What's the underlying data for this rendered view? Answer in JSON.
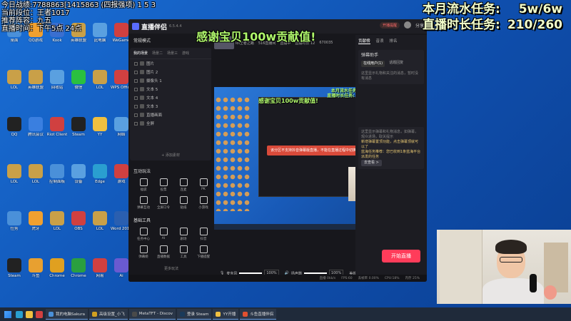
{
  "overlay": {
    "top_left": [
      "今日战绩:7788863[1415863 (四报强项) 1 5 3",
      "当前段位：王者1017",
      "推荐阵容：九五",
      "直播时间：下午5点 24点"
    ],
    "top_right": [
      {
        "label": "本月流水任务:",
        "value": "5w/6w"
      },
      {
        "label": "直播时长任务:",
        "value": "210/260"
      }
    ],
    "center_banner": "感谢宝贝100w贡献值!"
  },
  "desktop_icons": [
    {
      "label": "桌面",
      "color": "#4a90d9"
    },
    {
      "label": "QQ游戏",
      "color": "#f0a030"
    },
    {
      "label": "Kook",
      "color": "#3a6fd0"
    },
    {
      "label": "英雄联盟",
      "color": "#c9a048"
    },
    {
      "label": "此电脑",
      "color": "#5aa0e0"
    },
    {
      "label": "WeGame",
      "color": "#d04040"
    },
    {
      "label": "LOL",
      "color": "#c9a048"
    },
    {
      "label": "英雄联盟",
      "color": "#c9a048"
    },
    {
      "label": "回收站",
      "color": "#5aa0e0"
    },
    {
      "label": "微信",
      "color": "#2ac040"
    },
    {
      "label": "LOL",
      "color": "#c9a048"
    },
    {
      "label": "WPS Office",
      "color": "#d04040"
    },
    {
      "label": "QQ",
      "color": "#222"
    },
    {
      "label": "腾讯会议",
      "color": "#3a7fe0"
    },
    {
      "label": "Riot Client",
      "color": "#d04040"
    },
    {
      "label": "Steam",
      "color": "#222"
    },
    {
      "label": "YY",
      "color": "#f0c040"
    },
    {
      "label": "网络",
      "color": "#5aa0e0"
    },
    {
      "label": "LOL",
      "color": "#c9a048"
    },
    {
      "label": "LOL",
      "color": "#c9a048"
    },
    {
      "label": "控制面板",
      "color": "#4a90d9"
    },
    {
      "label": "设备",
      "color": "#5aa0e0"
    },
    {
      "label": "Edge",
      "color": "#2a9fd0"
    },
    {
      "label": "游戏",
      "color": "#d04040"
    },
    {
      "label": "任务",
      "color": "#4a90d9"
    },
    {
      "label": "虎牙",
      "color": "#f0a030"
    },
    {
      "label": "LOL",
      "color": "#c9a048"
    },
    {
      "label": "OBS",
      "color": "#d04040"
    },
    {
      "label": "LOL",
      "color": "#c9a048"
    },
    {
      "label": "Word 2016",
      "color": "#2a5fb0"
    },
    {
      "label": "Steam",
      "color": "#222"
    },
    {
      "label": "斗鱼",
      "color": "#e8a030"
    },
    {
      "label": "Chrome",
      "color": "#e0a020"
    },
    {
      "label": "Chrome",
      "color": "#2a9f40"
    },
    {
      "label": "网易",
      "color": "#d04040"
    },
    {
      "label": "Ai",
      "color": "#6a5ad0"
    }
  ],
  "app": {
    "name": "直播伴侣",
    "version": "6.5.4.4",
    "titlebar_right": [
      "开播提醒",
      "分享"
    ],
    "mode_label": "常规模式",
    "scene_label": "横屏",
    "scene_tabs": [
      "我的场景",
      "场景二",
      "场景三",
      "游戏"
    ],
    "sources": [
      "图片",
      "图片 2",
      "摄像头 1",
      "文本 5",
      "文本 4",
      "文本 3",
      "直播画面",
      "全屏"
    ],
    "add_source": "+ 添加素材",
    "interactive_title": "互动玩法",
    "interactive_tools": [
      "福袋",
      "投票",
      "连麦",
      "PK",
      "弹幕互动",
      "全屏口令",
      "贴纸",
      "小游戏"
    ],
    "basic_title": "基础工具",
    "basic_tools": [
      "任务中心",
      "AI",
      "剧场",
      "抖音",
      "弹幕姬",
      "直播数据",
      "工具",
      "下播提醒"
    ],
    "more_tools": "更多玩法",
    "room_bar": [
      "lol王者之路",
      "516直播间",
      "直播中",
      "直播时长 12",
      "670035"
    ],
    "preview_overlay_tr": [
      "本月流水任务: 5w/6w",
      "直播时长任务: 210/260"
    ],
    "preview_overlay_center": "感谢宝贝100w贡献值!",
    "preview_notice": "该分区不支持抖音弹幕版直播，不能在直播过程中切换",
    "controls": {
      "mic_label": "麦克风",
      "mic_value": "100%",
      "speaker_label": "扬声器",
      "speaker_value": "100%",
      "buttons": [
        "美颜",
        "录制",
        "设置"
      ]
    },
    "start_button": "开始直播",
    "status_bar": [
      "直播 0kb/s",
      "FPS:60",
      "丢帧率 0.00%",
      "CPU:18%",
      "内存 25%"
    ],
    "right_panel": {
      "tabs": [
        "贡献榜",
        "音浪",
        "排名"
      ],
      "box1_title": "弹幕助手",
      "box1_sub": [
        "在线用户(1)",
        "话题回复"
      ],
      "box1_text": "这里显示礼物和关注的消息，暂时没有消息",
      "box2_text": "这里显示弹幕和礼物消息，如弹幕，观众进场，取关提示",
      "notice": "新增弹幕置顶功能，点击弹幕顶就可以了",
      "notice2": "蓝海任务推荐：您已收到1条蓝海平台派发的任务",
      "more_btn": "去查看 >"
    }
  },
  "taskbar": {
    "apps": [
      {
        "label": "我的电脑Sakura",
        "color": "#4a90d9"
      },
      {
        "label": "高级设置_小飞",
        "color": "#d0a020"
      },
      {
        "label": "MetaTFT - Discov",
        "color": "#4a4a4a"
      },
      {
        "label": "登录 Steam",
        "color": "#1a3a5a"
      },
      {
        "label": "YY开播",
        "color": "#f0c040"
      },
      {
        "label": "斗鱼直播伴侣",
        "color": "#e05030"
      }
    ]
  }
}
